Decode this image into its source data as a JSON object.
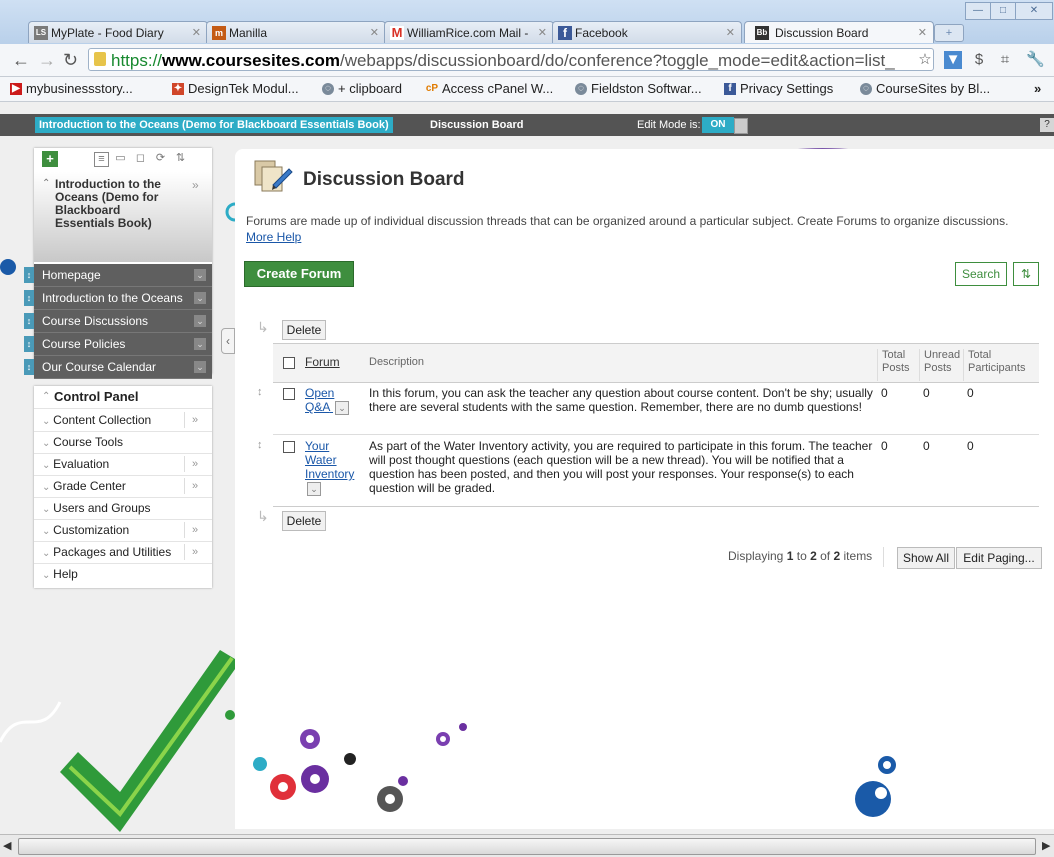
{
  "browser": {
    "tabs": [
      {
        "label": "MyPlate - Food Diary",
        "favicon": "LS",
        "color": "#7a7a7a"
      },
      {
        "label": "Manilla",
        "favicon": "m",
        "color": "#c45b15"
      },
      {
        "label": "WilliamRice.com Mail -",
        "favicon": "M",
        "color": "#d93025"
      },
      {
        "label": "Facebook",
        "favicon": "f",
        "color": "#3b5998"
      },
      {
        "label": "Discussion Board",
        "favicon": "Bb",
        "color": "#333333"
      }
    ],
    "new_tab": "+",
    "window_controls": {
      "minimize": "—",
      "maximize": "□",
      "close": "✕"
    },
    "url": {
      "scheme": "https://",
      "host": "www.coursesites.com",
      "path": "/webapps/discussionboard/do/conference?toggle_mode=edit&action=list_"
    },
    "bookmarks": [
      {
        "label": "mybusinessstory...",
        "icon": "youtube-icon",
        "color": "#cc1b1b"
      },
      {
        "label": "DesignTek Modul...",
        "icon": "designtek-icon",
        "color": "#d0462a"
      },
      {
        "label": "+ clipboard",
        "icon": "globe-icon",
        "color": "#7a8a9a"
      },
      {
        "label": "Access cPanel W...",
        "icon": "cpanel-icon",
        "color": "#e07b00"
      },
      {
        "label": "Fieldston Softwar...",
        "icon": "globe-icon",
        "color": "#7a8a9a"
      },
      {
        "label": "Privacy Settings",
        "icon": "facebook-icon",
        "color": "#3b5998"
      },
      {
        "label": "CourseSites by Bl...",
        "icon": "globe-icon",
        "color": "#7a8a9a"
      }
    ],
    "bookmarks_more": "»"
  },
  "topnav": {
    "course": "Introduction to the Oceans (Demo for Blackboard Essentials Book)",
    "current": "Discussion Board",
    "edit_mode_label": "Edit Mode is:",
    "edit_mode_value": "ON",
    "help": "?"
  },
  "course_menu": {
    "title": "Introduction to the Oceans (Demo for Blackboard Essentials Book)",
    "items": [
      {
        "label": "Homepage"
      },
      {
        "label": "Introduction to the Oceans"
      },
      {
        "label": "Course Discussions"
      },
      {
        "label": "Course Policies"
      },
      {
        "label": "Our Course Calendar"
      }
    ]
  },
  "control_panel": {
    "title": "Control Panel",
    "items": [
      {
        "label": "Content Collection",
        "more": true
      },
      {
        "label": "Course Tools",
        "more": false
      },
      {
        "label": "Evaluation",
        "more": true
      },
      {
        "label": "Grade Center",
        "more": true
      },
      {
        "label": "Users and Groups",
        "more": false
      },
      {
        "label": "Customization",
        "more": true
      },
      {
        "label": "Packages and Utilities",
        "more": true
      },
      {
        "label": "Help",
        "more": false
      }
    ]
  },
  "main": {
    "title": "Discussion Board",
    "intro": "Forums are made up of individual discussion threads that can be organized around a particular subject. Create Forums to organize discussions.",
    "more_help": "More Help",
    "create_forum": "Create Forum",
    "search": "Search",
    "delete": "Delete",
    "columns": {
      "forum": "Forum",
      "description": "Description",
      "total_posts": "Total Posts",
      "unread_posts": "Unread Posts",
      "total_participants": "Total Participants"
    },
    "rows": [
      {
        "forum": "Open Q&A",
        "description": "In this forum, you can ask the teacher any question about course content. Don't be shy; usually there are several students with the same question. Remember, there are no dumb questions!",
        "total_posts": "0",
        "unread_posts": "0",
        "participants": "0"
      },
      {
        "forum": "Your Water Inventory",
        "description": "As part of the Water Inventory activity, you are required to participate in this forum. The teacher will post thought questions (each question will be a new thread). You will be notified that a question has been posted, and then you will post your responses. Your response(s) to each question will be graded.",
        "total_posts": "0",
        "unread_posts": "0",
        "participants": "0"
      }
    ],
    "paging": {
      "prefix": "Displaying",
      "from": "1",
      "to_word": "to",
      "to": "2",
      "of_word": "of",
      "total": "2",
      "suffix": "items"
    },
    "show_all": "Show All",
    "edit_paging": "Edit Paging..."
  }
}
